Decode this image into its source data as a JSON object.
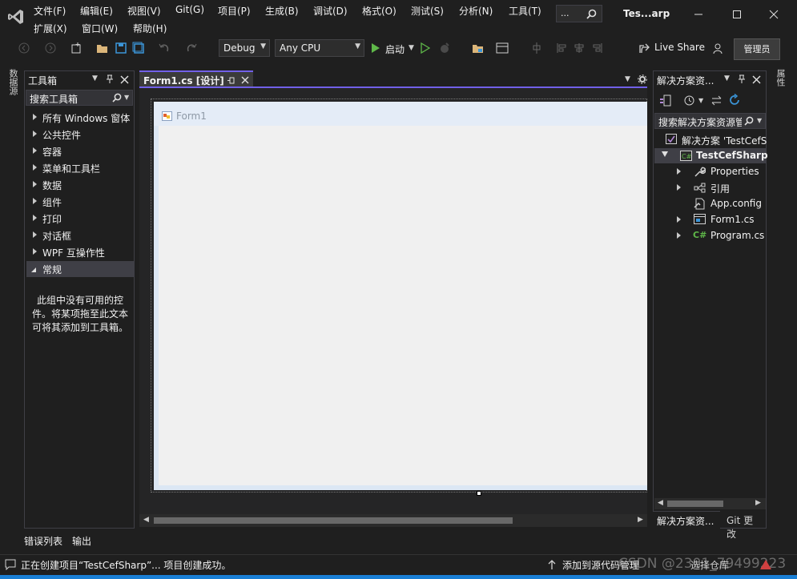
{
  "menu": {
    "file": "文件(F)",
    "edit": "编辑(E)",
    "view": "视图(V)",
    "git": "Git(G)",
    "project": "项目(P)",
    "build": "生成(B)",
    "debug": "调试(D)",
    "format": "格式(O)",
    "test": "测试(S)",
    "analyze": "分析(N)",
    "tools": "工具(T)",
    "extensions": "扩展(X)",
    "window": "窗口(W)",
    "help": "帮助(H)"
  },
  "search": {
    "text": "..."
  },
  "window_title": "Tes...arp",
  "toolbar": {
    "config": "Debug",
    "platform": "Any CPU",
    "start": "启动",
    "live_share": "Live Share",
    "admin": "管理员"
  },
  "left_strip": {
    "data_sources": "数据源"
  },
  "right_strip": {
    "properties": "属性"
  },
  "toolbox": {
    "title": "工具箱",
    "search_placeholder": "搜索工具箱",
    "groups": [
      "所有 Windows 窗体",
      "公共控件",
      "容器",
      "菜单和工具栏",
      "数据",
      "组件",
      "打印",
      "对话框",
      "WPF 互操作性",
      "常规"
    ],
    "empty_message": "此组中没有可用的控件。将某项拖至此文本可将其添加到工具箱。"
  },
  "document": {
    "tab_label": "Form1.cs [设计]",
    "form_title": "Form1"
  },
  "solution": {
    "title": "解决方案资...",
    "search_placeholder": "搜索解决方案资源管",
    "items": [
      "解决方案 'TestCefS",
      "TestCefSharp",
      "Properties",
      "引用",
      "App.config",
      "Form1.cs",
      "Program.cs"
    ],
    "tab_solution": "解决方案资...",
    "tab_git": "Git 更改"
  },
  "bottom_tabs": {
    "errors": "错误列表",
    "output": "输出"
  },
  "status": {
    "message": "正在创建项目“TestCefSharp”... 项目创建成功。",
    "source_control": "添加到源代码管理",
    "repo": "选择仓库",
    "watermark": "CSDN @2301_79499223"
  },
  "colors": {
    "accent": "#7160e8",
    "status_blue": "#1a7fd4",
    "play_green": "#5fb849"
  }
}
